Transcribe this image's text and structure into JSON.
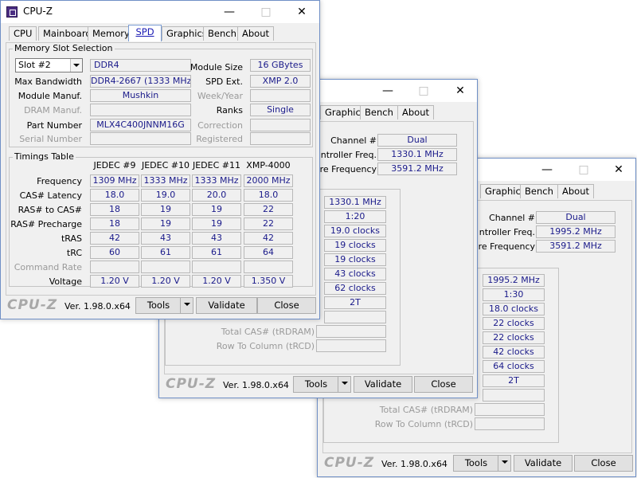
{
  "app": {
    "title": "CPU-Z",
    "version": "Ver. 1.98.0.x64",
    "logo": "CPU-Z"
  },
  "titlebar": {
    "minimize": "—",
    "maximize": "□",
    "close": "✕"
  },
  "tabs": [
    "CPU",
    "Mainboard",
    "Memory",
    "SPD",
    "Graphics",
    "Bench",
    "About"
  ],
  "buttons": {
    "tools": "Tools",
    "validate": "Validate",
    "close": "Close"
  },
  "spd": {
    "slot_group": "Memory Slot Selection",
    "slot_value": "Slot #2",
    "type": "DDR4",
    "labels": {
      "max_bw": "Max Bandwidth",
      "module_manuf": "Module Manuf.",
      "dram_manuf": "DRAM Manuf.",
      "part": "Part Number",
      "serial": "Serial Number",
      "module_size": "Module Size",
      "spd_ext": "SPD Ext.",
      "week_year": "Week/Year",
      "ranks": "Ranks",
      "correction": "Correction",
      "registered": "Registered"
    },
    "values": {
      "max_bw": "DDR4-2667 (1333 MHz)",
      "module_manuf": "Mushkin",
      "dram_manuf": "",
      "part": "MLX4C400JNNM16G",
      "serial": "",
      "module_size": "16 GBytes",
      "spd_ext": "XMP 2.0",
      "week_year": "",
      "ranks": "Single",
      "correction": "",
      "registered": ""
    },
    "timings_group": "Timings Table",
    "columns": [
      "JEDEC #9",
      "JEDEC #10",
      "JEDEC #11",
      "XMP-4000"
    ],
    "rows": [
      {
        "label": "Frequency",
        "values": [
          "1309 MHz",
          "1333 MHz",
          "1333 MHz",
          "2000 MHz"
        ]
      },
      {
        "label": "CAS# Latency",
        "values": [
          "18.0",
          "19.0",
          "20.0",
          "18.0"
        ]
      },
      {
        "label": "RAS# to CAS#",
        "values": [
          "18",
          "19",
          "19",
          "22"
        ]
      },
      {
        "label": "RAS# Precharge",
        "values": [
          "18",
          "19",
          "19",
          "22"
        ]
      },
      {
        "label": "tRAS",
        "values": [
          "42",
          "43",
          "43",
          "42"
        ]
      },
      {
        "label": "tRC",
        "values": [
          "60",
          "61",
          "61",
          "64"
        ]
      },
      {
        "label": "Command Rate",
        "values": [
          "",
          "",
          "",
          ""
        ]
      },
      {
        "label": "Voltage",
        "values": [
          "1.20 V",
          "1.20 V",
          "1.20 V",
          "1.350 V"
        ]
      }
    ]
  },
  "memory_mid": {
    "channel_label": "Channel #",
    "channel": "Dual",
    "ctrl_label": "ntroller Freq.",
    "ctrl": "1330.1 MHz",
    "core_label": "re Frequency",
    "core": "3591.2 MHz",
    "timings": [
      "1330.1 MHz",
      "1:20",
      "19.0 clocks",
      "19 clocks",
      "19 clocks",
      "43 clocks",
      "62 clocks",
      "2T"
    ],
    "total_cas": "Total CAS# (tRDRAM)",
    "row_col": "Row To Column (tRCD)"
  },
  "memory_back": {
    "channel_label": "Channel #",
    "channel": "Dual",
    "ctrl_label": "ntroller Freq.",
    "ctrl": "1995.2 MHz",
    "core_label": "re Frequency",
    "core": "3591.2 MHz",
    "timings": [
      "1995.2 MHz",
      "1:30",
      "18.0 clocks",
      "22 clocks",
      "22 clocks",
      "42 clocks",
      "64 clocks",
      "2T"
    ],
    "total_cas": "Total CAS# (tRDRAM)",
    "row_col": "Row To Column (tRCD)"
  }
}
